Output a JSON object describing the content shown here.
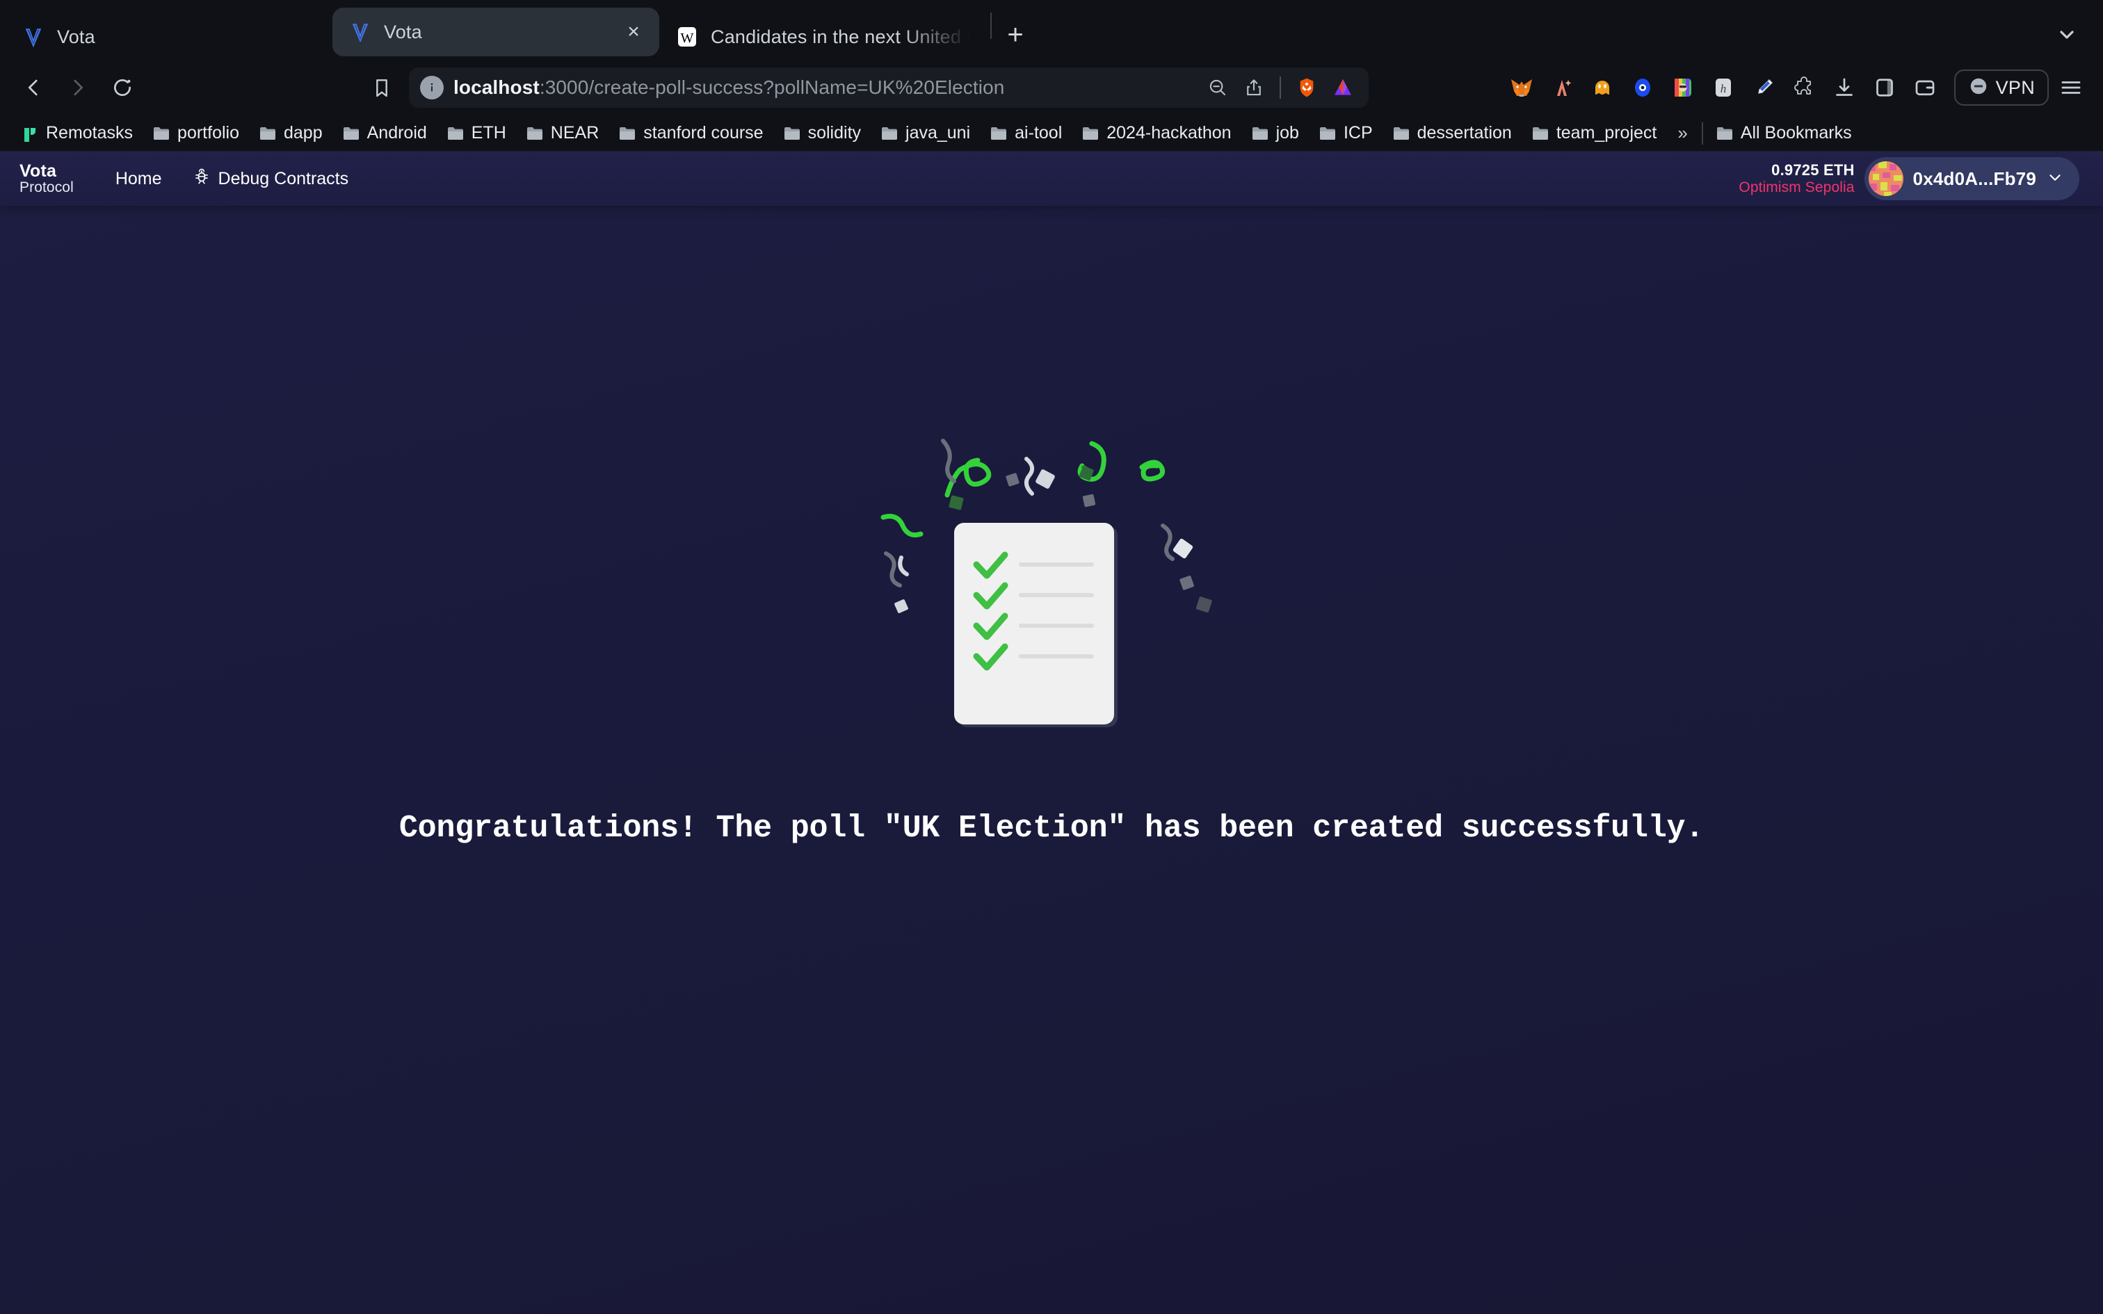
{
  "browser": {
    "tabs": [
      {
        "title": "Vota",
        "favicon": "vota-logo",
        "state": "background"
      },
      {
        "title": "Vota",
        "favicon": "vota-logo",
        "state": "active",
        "close_label": "×"
      },
      {
        "title": "Candidates in the next United King",
        "favicon": "wikipedia-w",
        "state": "background-truncated"
      }
    ],
    "new_tab_label": "+",
    "toolbar": {
      "back_label": "Back",
      "forward_label": "Forward",
      "reload_label": "Reload",
      "bookmark_label": "Bookmark this tab",
      "url_host": "localhost",
      "url_rest": ":3000/create-poll-success?pollName=UK%20Election",
      "full_url": "localhost:3000/create-poll-success?pollName=UK%20Election",
      "vpn_label": "VPN",
      "extensions": [
        "metamask-fox-icon",
        "claude-ai-icon",
        "phantom-wallet-icon",
        "worldcoin-icon",
        "rainbow-wallet-icon",
        "hashpack-icon",
        "eyedropper-pen-icon",
        "puzzle-extensions-icon",
        "download-icon",
        "sidebar-panel-icon",
        "wallet-card-icon"
      ],
      "menu_label": "Customize and control Brave"
    },
    "bookmarks": [
      {
        "label": "Remotasks",
        "icon": "remotasks-logo"
      },
      {
        "label": "portfolio",
        "icon": "folder"
      },
      {
        "label": "dapp",
        "icon": "folder"
      },
      {
        "label": "Android",
        "icon": "folder"
      },
      {
        "label": "ETH",
        "icon": "folder"
      },
      {
        "label": "NEAR",
        "icon": "folder"
      },
      {
        "label": "stanford course",
        "icon": "folder"
      },
      {
        "label": "solidity",
        "icon": "folder"
      },
      {
        "label": "java_uni",
        "icon": "folder"
      },
      {
        "label": "ai-tool",
        "icon": "folder"
      },
      {
        "label": "2024-hackathon",
        "icon": "folder"
      },
      {
        "label": "job",
        "icon": "folder"
      },
      {
        "label": "ICP",
        "icon": "folder"
      },
      {
        "label": "dessertation",
        "icon": "folder"
      },
      {
        "label": "team_project",
        "icon": "folder"
      }
    ],
    "bookmarks_overflow_label": "»",
    "all_bookmarks_label": "All Bookmarks"
  },
  "app": {
    "brand": {
      "name": "Vota",
      "subtitle": "Protocol"
    },
    "nav": [
      {
        "label": "Home",
        "icon": ""
      },
      {
        "label": "Debug Contracts",
        "icon": "bug-icon"
      }
    ],
    "wallet": {
      "balance": "0.9725 ETH",
      "network": "Optimism Sepolia",
      "address": "0x4d0A...Fb79",
      "chevron": "⌄"
    },
    "hero": {
      "illustration": "checklist-with-confetti",
      "message": "Congratulations! The poll \"UK Election\" has been created successfully.",
      "poll_name": "UK Election",
      "checklist_items": 4
    }
  },
  "colors": {
    "page_bg": "#1a1a3c",
    "header_bg": "#1f1f46",
    "accent_green": "#34d23a",
    "network_red": "#f2346b",
    "chrome_bg": "#0f1116",
    "omnibox_bg": "#191c22",
    "card_white": "#f0f0f0"
  }
}
